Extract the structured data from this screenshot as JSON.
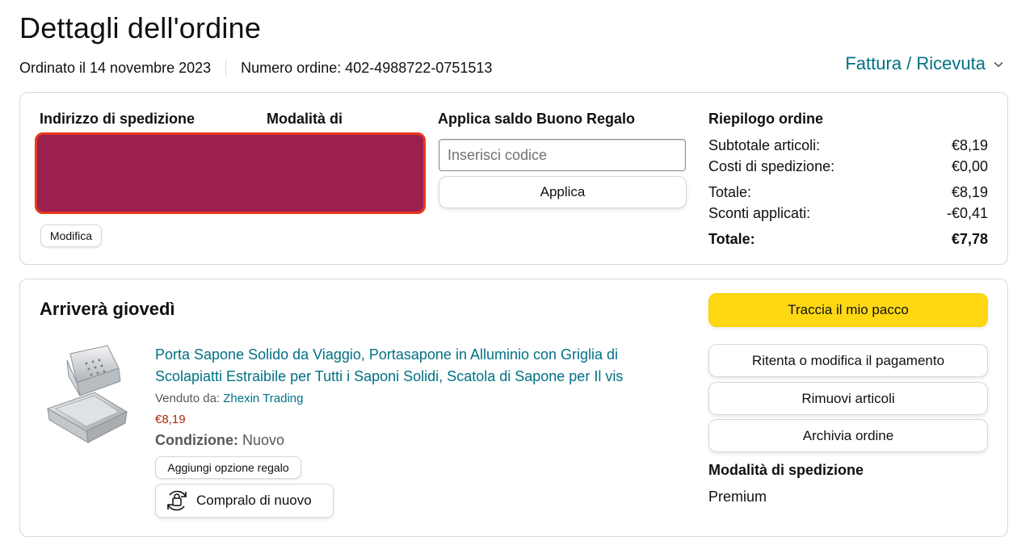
{
  "header": {
    "title": "Dettagli dell'ordine",
    "ordered_on": "Ordinato il 14 novembre 2023",
    "order_number": "Numero ordine: 402-4988722-0751513",
    "invoice_link": "Fattura / Ricevuta",
    "invoice_icon": "chevron-down-icon"
  },
  "summary_box": {
    "shipping_address_heading": "Indirizzo di spedizione",
    "payment_method_heading": "Modalità di",
    "edit_button": "Modifica",
    "gift_card": {
      "heading": "Applica saldo Buono Regalo",
      "placeholder": "Inserisci codice",
      "value": "",
      "apply_button": "Applica"
    },
    "order_summary": {
      "heading": "Riepilogo ordine",
      "rows": [
        {
          "label": "Subtotale articoli:",
          "value": "€8,19"
        },
        {
          "label": "Costi di spedizione:",
          "value": "€0,00"
        },
        {
          "label": "Totale:",
          "value": "€8,19"
        },
        {
          "label": "Sconti applicati:",
          "value": "-€0,41"
        }
      ],
      "grand_total": {
        "label": "Totale:",
        "value": "€7,78"
      }
    },
    "redaction_color": "#9b204d"
  },
  "delivery_box": {
    "arrival": "Arriverà giovedì",
    "product": {
      "title": "Porta Sapone Solido da Viaggio, Portasapone in Alluminio con Griglia di Scolapiatti Estraibile per Tutti i Saponi Solidi, Scatola di Sapone per Il vis",
      "sold_by_label": "Venduto da:",
      "seller": "Zhexin Trading",
      "price": "€8,19",
      "condition_label": "Condizione:",
      "condition_value": "Nuovo",
      "gift_option_button": "Aggiungi opzione regalo",
      "buy_again_button": "Compralo di nuovo",
      "buy_again_icon": "buy-again-icon"
    },
    "actions": {
      "track": "Traccia il mio pacco",
      "retry_payment": "Ritenta o modifica il pagamento",
      "remove_items": "Rimuovi articoli",
      "archive": "Archivia ordine"
    },
    "shipping_method_heading": "Modalità di spedizione",
    "shipping_method_value": "Premium"
  },
  "colors": {
    "link": "#007185",
    "primary_button": "#ffd814",
    "price": "#b12704",
    "border": "#d5d9d9"
  }
}
